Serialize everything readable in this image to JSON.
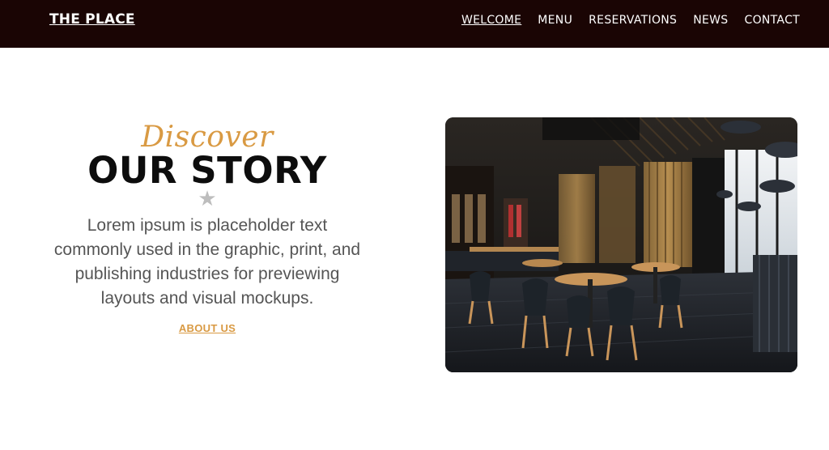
{
  "nav": {
    "brand": "THE PLACE",
    "links": [
      {
        "label": "WELCOME",
        "active": true
      },
      {
        "label": "MENU",
        "active": false
      },
      {
        "label": "RESERVATIONS",
        "active": false
      },
      {
        "label": "NEWS",
        "active": false
      },
      {
        "label": "CONTACT",
        "active": false
      }
    ]
  },
  "story": {
    "kicker": "Discover",
    "title": "OUR STORY",
    "divider_icon": "star-icon",
    "body": "Lorem ipsum is placeholder text commonly used in the graphic, print, and publishing industries for previewing layouts and visual mockups.",
    "link_label": "ABOUT US"
  },
  "photo": {
    "subject": "restaurant-interior-image"
  },
  "colors": {
    "nav_bg": "#1a0504",
    "accent": "#d99a43",
    "heading": "#0d0d0d",
    "body_text": "#555555",
    "star": "#bdbdbd"
  }
}
